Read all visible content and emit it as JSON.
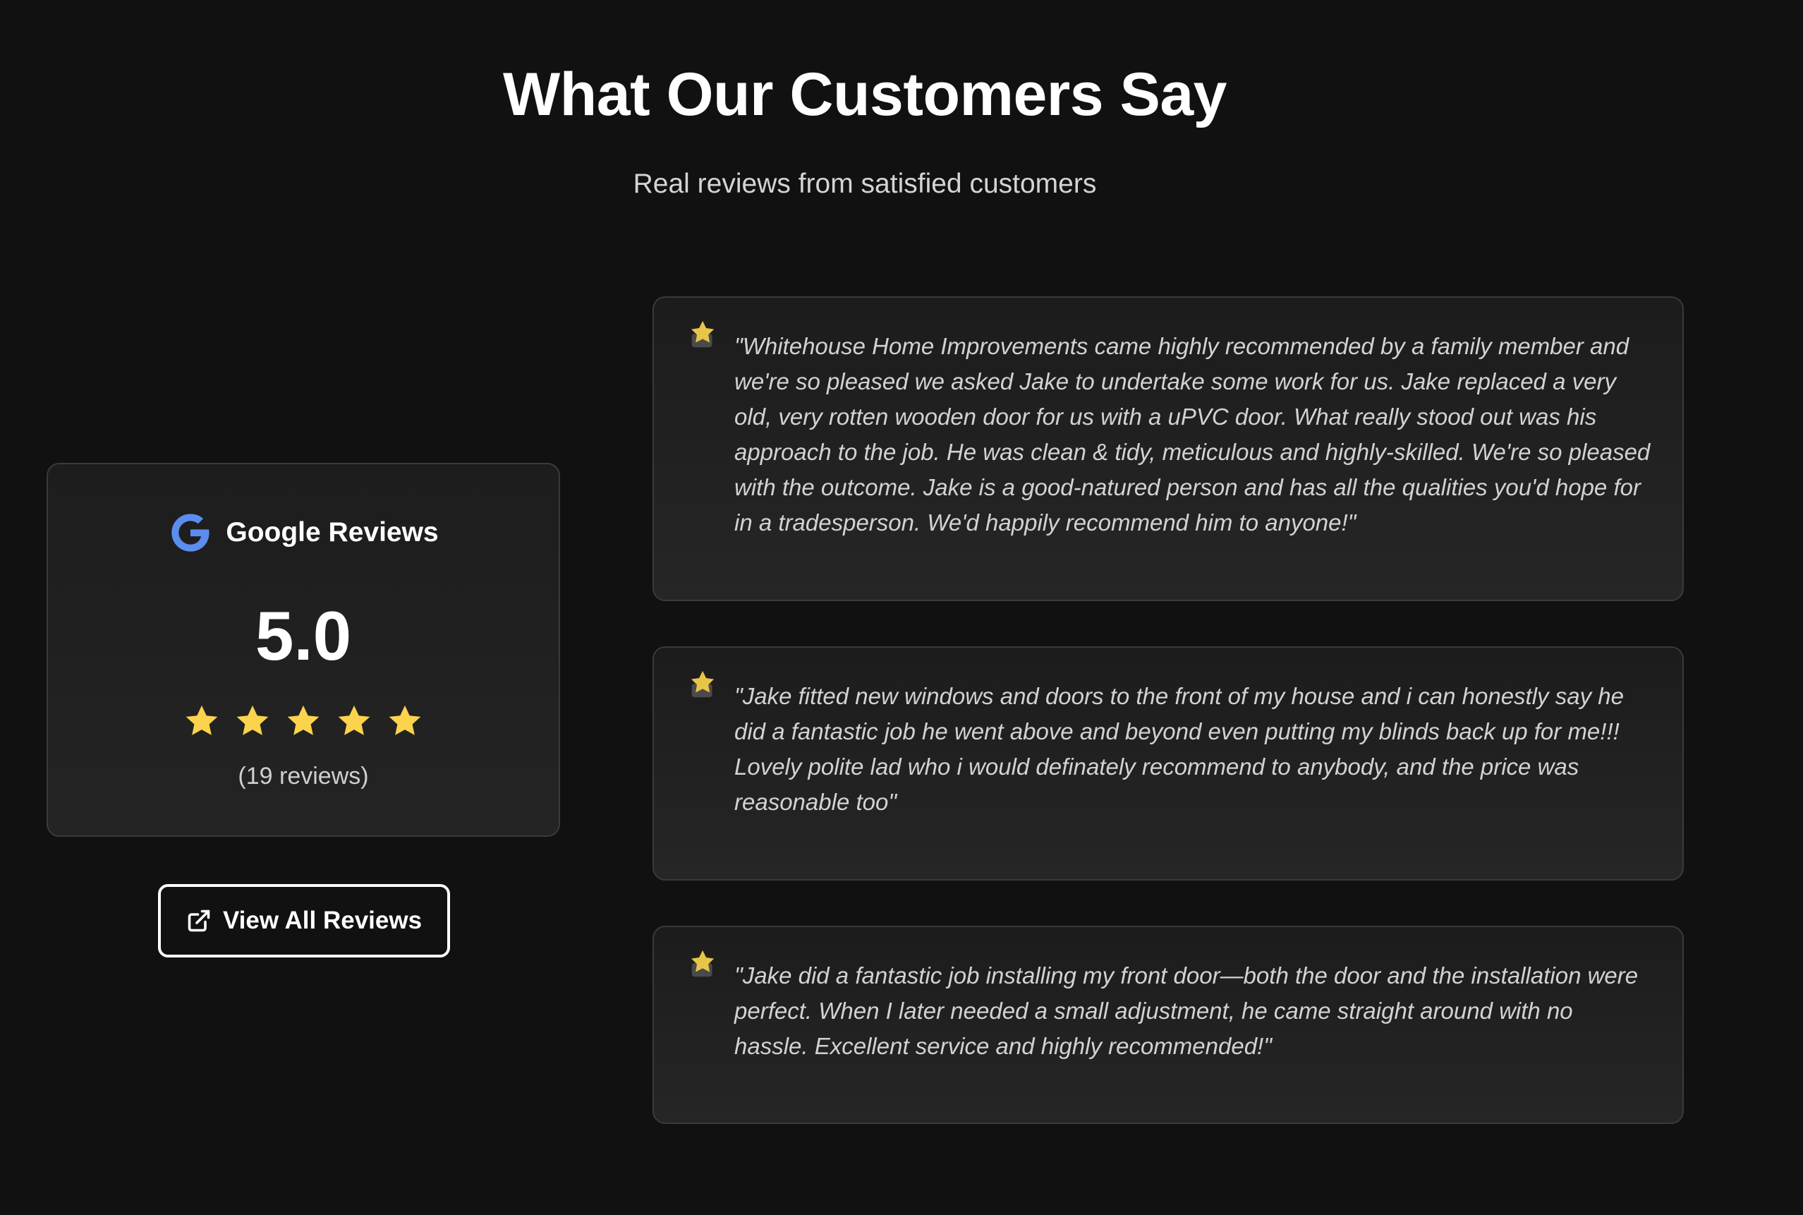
{
  "header": {
    "title": "What Our Customers Say",
    "subtitle": "Real reviews from satisfied customers"
  },
  "summary": {
    "brand_icon": "google-g-icon",
    "brand_label": "Google Reviews",
    "rating": "5.0",
    "stars": 5,
    "star_color": "#fcd34d",
    "review_count": "(19 reviews)"
  },
  "view_all_button": {
    "icon": "external-link-icon",
    "label": "View All Reviews"
  },
  "reviews": [
    {
      "icon": "star-icon",
      "text": "\"Whitehouse Home Improvements came highly recommended by a family member and we're so pleased we asked Jake to undertake some work for us. Jake replaced a very old, very rotten wooden door for us with a uPVC door. What really stood out was his approach to the job. He was clean & tidy, meticulous and highly-skilled. We're so pleased with the outcome. Jake is a good-natured person and has all the qualities you'd hope for in a tradesperson. We'd happily recommend him to anyone!\""
    },
    {
      "icon": "star-icon",
      "text": "\"Jake fitted new windows and doors to the front of my house and i can honestly say he did a fantastic job he went above and beyond even putting my blinds back up for me!!! Lovely polite lad who i would definately recommend to anybody, and the price was reasonable too\""
    },
    {
      "icon": "star-icon",
      "text": "\"Jake did a fantastic job installing my front door—both the door and the installation were perfect. When I later needed a small adjustment, he came straight around with no hassle. Excellent service and highly recommended!\""
    }
  ],
  "colors": {
    "background": "#111111",
    "card_border": "#3a3a3a",
    "google_blue": "#4285f4",
    "star": "#fcd34d"
  }
}
